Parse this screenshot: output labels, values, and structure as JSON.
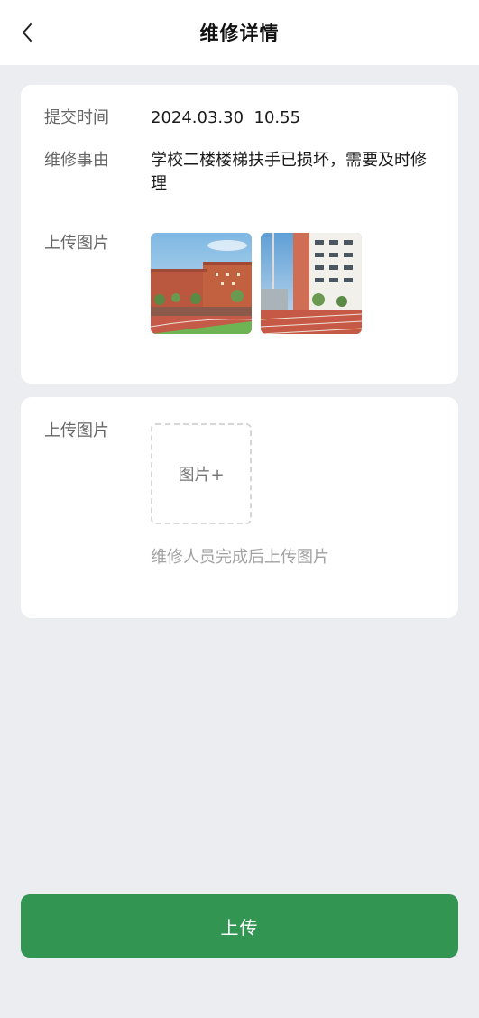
{
  "header": {
    "title": "维修详情",
    "back_icon": "chevron-left-icon"
  },
  "detail": {
    "submit_time_label": "提交时间",
    "submit_time": "2024.03.30  10.55",
    "reason_label": "维修事由",
    "reason": "学校二楼楼梯扶手已损坏，需要及时修理",
    "images_label": "上传图片",
    "images": [
      {
        "name": "campus-building-photo"
      },
      {
        "name": "campus-track-photo"
      }
    ]
  },
  "after_repair": {
    "images_label": "上传图片",
    "add_image_label": "图片+",
    "hint": "维修人员完成后上传图片"
  },
  "submit_button": {
    "label": "上传",
    "color": "#339552"
  }
}
